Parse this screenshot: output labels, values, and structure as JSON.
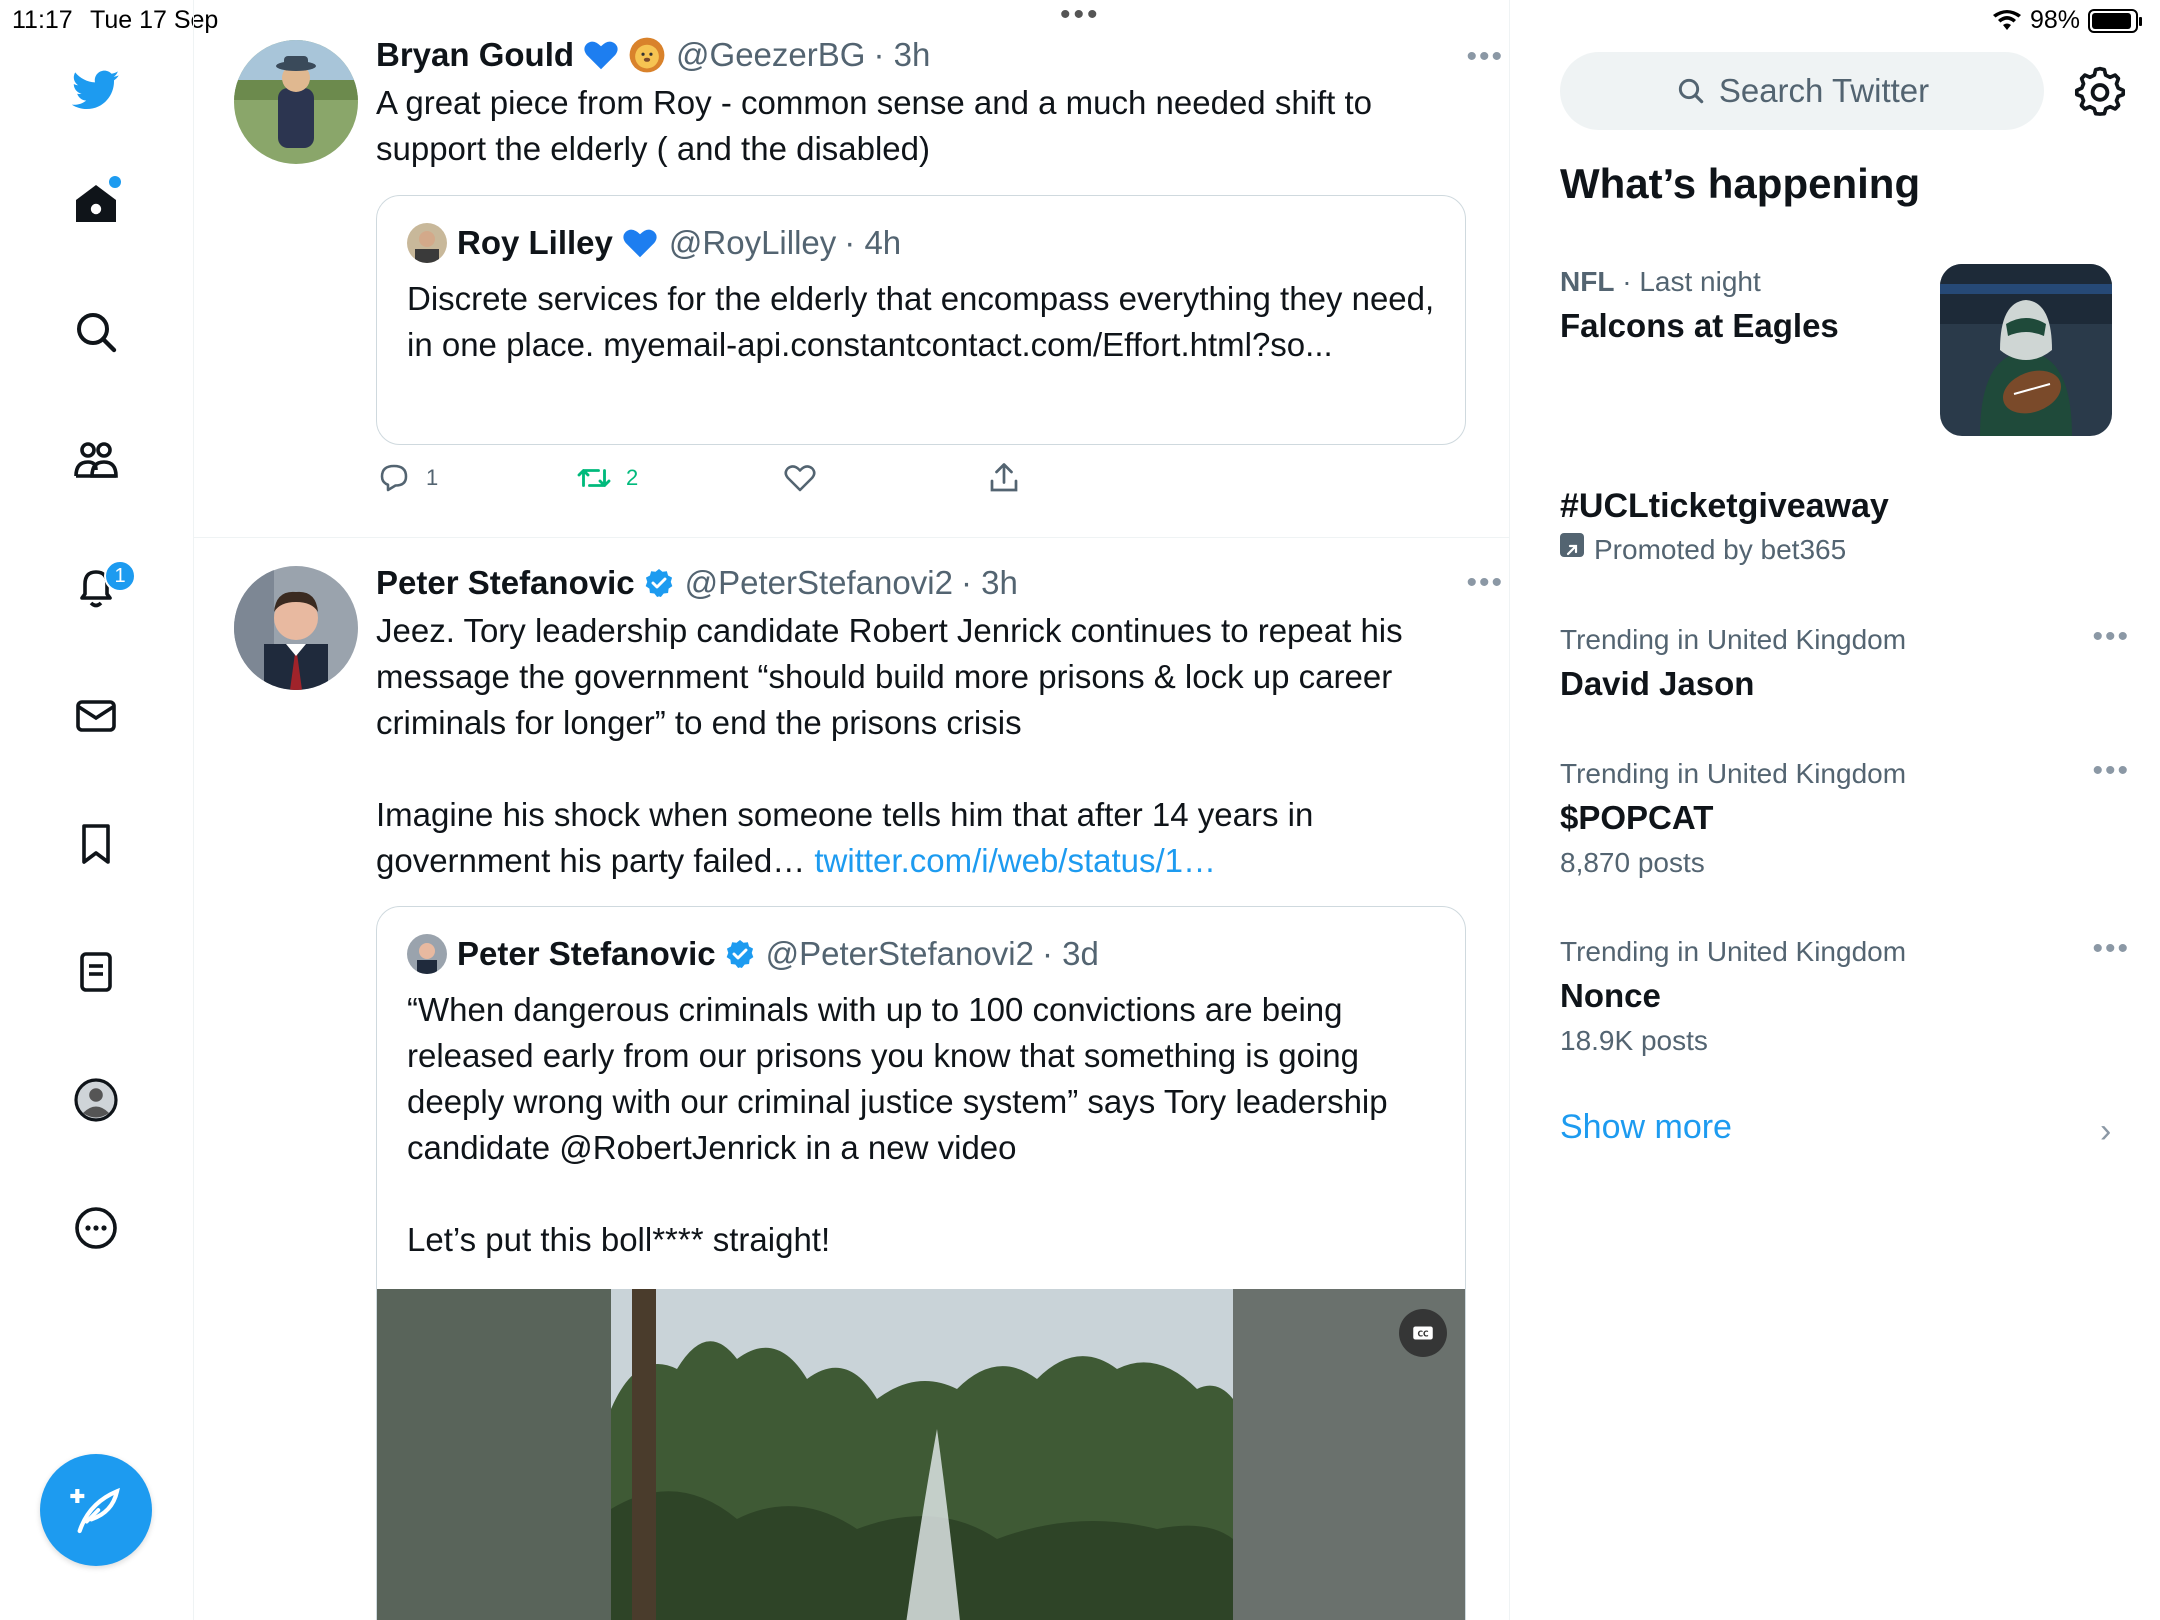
{
  "status": {
    "time": "11:17",
    "date": "Tue 17 Sep",
    "battery": "98%"
  },
  "nav": {
    "notifications_badge": "1"
  },
  "tweets": [
    {
      "author": "Bryan Gould",
      "handle": "@GeezerBG",
      "time": "· 3h",
      "text": "A great piece from Roy - common sense and a much needed shift to support the elderly ( and the disabled)",
      "quote": {
        "author": "Roy Lilley",
        "handle": "@RoyLilley",
        "time": "· 4h",
        "text": "Discrete services for the elderly that encompass everything they need, in one place. myemail-api.constantcontact.com/Effort.html?so..."
      },
      "replies": "1",
      "retweets": "2"
    },
    {
      "author": "Peter Stefanovic",
      "handle": "@PeterStefanovi2",
      "time": "· 3h",
      "text": "Jeez. Tory leadership candidate Robert Jenrick continues to repeat his message the government “should build more prisons & lock up career criminals for longer” to end the prisons crisis\n\nImagine his shock when someone tells him that after 14 years in government his party failed… ",
      "link": "twitter.com/i/web/status/1…",
      "quote": {
        "author": "Peter Stefanovic",
        "handle": "@PeterStefanovi2",
        "time": "· 3d",
        "text": "“When dangerous criminals with up to 100 convictions are being released early from our prisons you know that something is going deeply wrong with our criminal justice system” says Tory leadership candidate @RobertJenrick in a new video\n\nLet’s put this boll**** straight!"
      }
    }
  ],
  "sidebar": {
    "search_placeholder": "Search Twitter",
    "section_title": "What’s happening",
    "trends": [
      {
        "category": "NFL",
        "meta": " · Last night",
        "title": "Falcons at Eagles"
      },
      {
        "title": "#UCLticketgiveaway",
        "meta": "Promoted by bet365"
      },
      {
        "meta": "Trending in United Kingdom",
        "title": "David Jason"
      },
      {
        "meta": "Trending in United Kingdom",
        "title": "$POPCAT",
        "posts": "8,870 posts"
      },
      {
        "meta": "Trending in United Kingdom",
        "title": "Nonce",
        "posts": "18.9K posts"
      }
    ],
    "show_more": "Show more"
  }
}
